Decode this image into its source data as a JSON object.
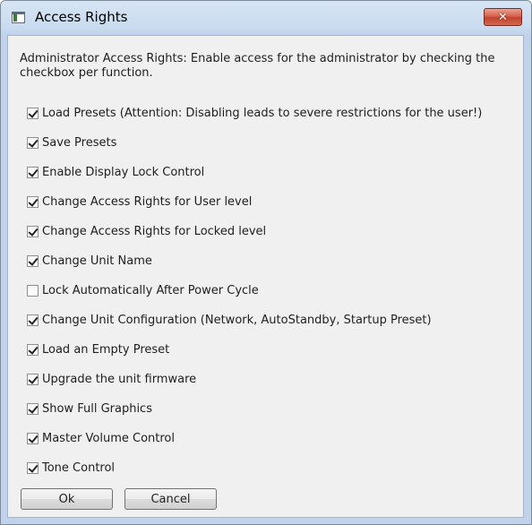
{
  "window": {
    "title": "Access Rights",
    "close_glyph": "✕"
  },
  "description": "Administrator Access Rights: Enable access for the administrator by checking the checkbox per function.",
  "options": [
    {
      "label": "Load Presets (Attention: Disabling leads to severe restrictions for the user!)",
      "checked": true
    },
    {
      "label": "Save Presets",
      "checked": true
    },
    {
      "label": "Enable Display Lock Control",
      "checked": true
    },
    {
      "label": "Change Access Rights for User level",
      "checked": true
    },
    {
      "label": "Change Access Rights for Locked level",
      "checked": true
    },
    {
      "label": "Change Unit Name",
      "checked": true
    },
    {
      "label": "Lock Automatically After Power Cycle",
      "checked": false
    },
    {
      "label": "Change Unit Configuration (Network, AutoStandby, Startup Preset)",
      "checked": true
    },
    {
      "label": "Load an Empty Preset",
      "checked": true
    },
    {
      "label": "Upgrade the unit firmware",
      "checked": true
    },
    {
      "label": "Show Full Graphics",
      "checked": true
    },
    {
      "label": "Master Volume Control",
      "checked": true
    },
    {
      "label": "Tone Control",
      "checked": true
    }
  ],
  "buttons": {
    "ok_label": "Ok",
    "cancel_label": "Cancel"
  }
}
